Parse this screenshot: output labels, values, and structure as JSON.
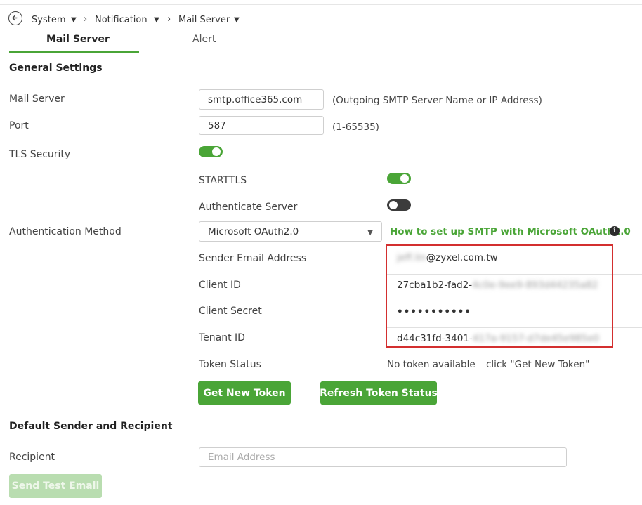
{
  "breadcrumb": {
    "items": [
      "System",
      "Notification",
      "Mail Server"
    ]
  },
  "tabs": [
    {
      "label": "Mail Server",
      "active": true
    },
    {
      "label": "Alert",
      "active": false
    }
  ],
  "general": {
    "title": "General Settings",
    "mail_server": {
      "label": "Mail Server",
      "value": "smtp.office365.com",
      "hint": "(Outgoing SMTP Server Name or IP Address)"
    },
    "port": {
      "label": "Port",
      "value": "587",
      "hint": "(1-65535)"
    },
    "tls": {
      "label": "TLS Security",
      "enabled": true
    },
    "starttls": {
      "label": "STARTTLS",
      "enabled": true
    },
    "auth_server": {
      "label": "Authenticate Server",
      "enabled": false
    },
    "auth_method": {
      "label": "Authentication Method",
      "value": "Microsoft OAuth2.0",
      "help_link": "How to set up SMTP with Microsoft OAuth2.0"
    },
    "sender_email": {
      "label": "Sender Email Address",
      "value_visible": "@zyxel.com.tw",
      "value_blurred": "jeff.lin"
    },
    "client_id": {
      "label": "Client ID",
      "value_visible": "27cba1b2-fad2-",
      "value_blurred": "4c0e-9ee9-893d44235a82"
    },
    "client_secret": {
      "label": "Client Secret",
      "value": "•••••••••••"
    },
    "tenant_id": {
      "label": "Tenant ID",
      "value_visible": "d44c31fd-3401-",
      "value_blurred": "417a-9157-d7de45e985e0"
    },
    "token_status": {
      "label": "Token Status",
      "value": "No token available – click \"Get New Token\""
    },
    "get_token_label": "Get New Token",
    "refresh_token_label": "Refresh Token Status"
  },
  "defaults": {
    "title": "Default Sender and Recipient",
    "recipient": {
      "label": "Recipient",
      "placeholder": "Email Address"
    },
    "send_test_label": "Send Test Email"
  },
  "colors": {
    "accent": "#4aa537",
    "highlight_box": "#d32f2f"
  },
  "icons": {
    "back": "back-arrow-circle-icon",
    "dropdown": "caret-down-icon",
    "separator": "chevron-right-icon",
    "info": "info-icon"
  }
}
